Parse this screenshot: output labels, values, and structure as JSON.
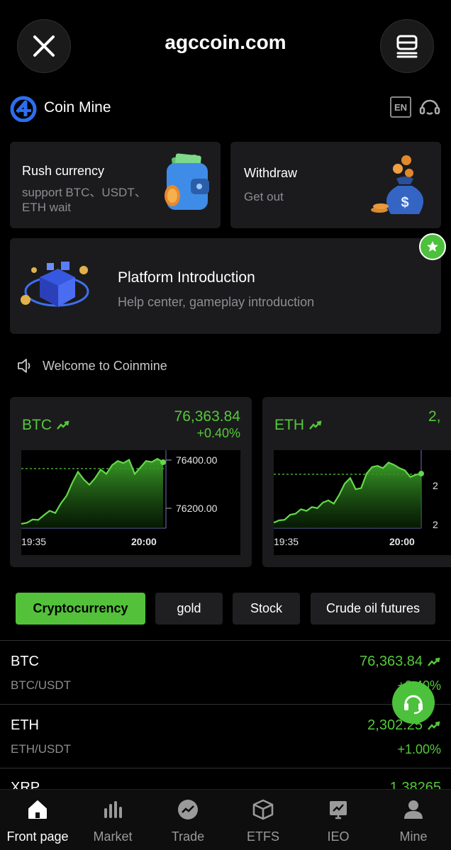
{
  "browser": {
    "title": "agccoin.com"
  },
  "app": {
    "brand": "Coin Mine",
    "lang": "EN"
  },
  "cards": {
    "rush": {
      "title": "Rush currency",
      "sub1": "support BTC、USDT、",
      "sub2": "ETH wait"
    },
    "withdraw": {
      "title": "Withdraw",
      "sub": "Get out"
    },
    "platform": {
      "title": "Platform Introduction",
      "sub": "Help center, gameplay introduction"
    }
  },
  "notice": {
    "text": "Welcome to Coinmine"
  },
  "charts": [
    {
      "symbol": "BTC",
      "price": "76,363.84",
      "change": "+0.40%",
      "y_top": "76400.00",
      "y_bottom": "76200.00",
      "x_start": "19:35",
      "x_end": "20:00"
    },
    {
      "symbol": "ETH",
      "price": "2,",
      "change": "",
      "y_top": "2",
      "y_bottom": "2",
      "x_start": "19:35",
      "x_end": "20:00"
    }
  ],
  "chart_data": [
    {
      "type": "area",
      "series": [
        {
          "values": [
            76100,
            76105,
            76120,
            76118,
            76140,
            76160,
            76150,
            76195,
            76230,
            76290,
            76340,
            76305,
            76280,
            76310,
            76350,
            76330,
            76370,
            76390,
            76380,
            76395,
            76330,
            76360,
            76390,
            76385,
            76400,
            76384
          ]
        }
      ],
      "ylim": [
        76080,
        76420
      ],
      "xlabel": "",
      "ylabel": ""
    },
    {
      "type": "area",
      "series": [
        {
          "values": [
            10,
            14,
            15,
            24,
            26,
            34,
            31,
            38,
            36,
            46,
            50,
            44,
            60,
            80,
            90,
            70,
            72,
            98,
            110,
            112,
            108,
            118,
            114,
            108,
            104,
            92,
            96,
            98
          ]
        }
      ],
      "ylim": [
        0,
        130
      ],
      "xlabel": "",
      "ylabel": ""
    }
  ],
  "tabs": [
    "Cryptocurrency",
    "gold",
    "Stock",
    "Crude oil futures"
  ],
  "list": [
    {
      "name": "BTC",
      "pair": "BTC/USDT",
      "price": "76,363.84",
      "change": "+0.40%"
    },
    {
      "name": "ETH",
      "pair": "ETH/USDT",
      "price": "2,302.25",
      "change": "+1.00%"
    },
    {
      "name": "XRP",
      "price": "1.38265"
    }
  ],
  "nav": [
    "Front page",
    "Market",
    "Trade",
    "ETFS",
    "IEO",
    "Mine"
  ],
  "colors": {
    "accent": "#53c23a",
    "card": "#1b1b1d",
    "background": "#000000"
  }
}
